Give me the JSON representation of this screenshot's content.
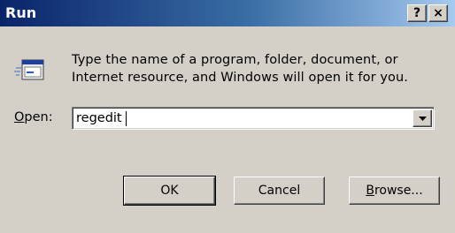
{
  "window": {
    "title": "Run",
    "help_button": "?",
    "close_button": "×"
  },
  "dialog": {
    "icon": "run-program-icon",
    "description_line1": "Type the name of a program, folder, document, or",
    "description_line2": "Internet resource, and Windows will open it for you.",
    "open_label_accel": "O",
    "open_label_rest": "pen:",
    "open_value": "regedit"
  },
  "buttons": {
    "ok": "OK",
    "cancel": "Cancel",
    "browse_accel": "B",
    "browse_rest": "rowse..."
  },
  "colors": {
    "face": "#d4d0c8",
    "titlebar_start": "#0a246a",
    "titlebar_end": "#a6caf0"
  }
}
